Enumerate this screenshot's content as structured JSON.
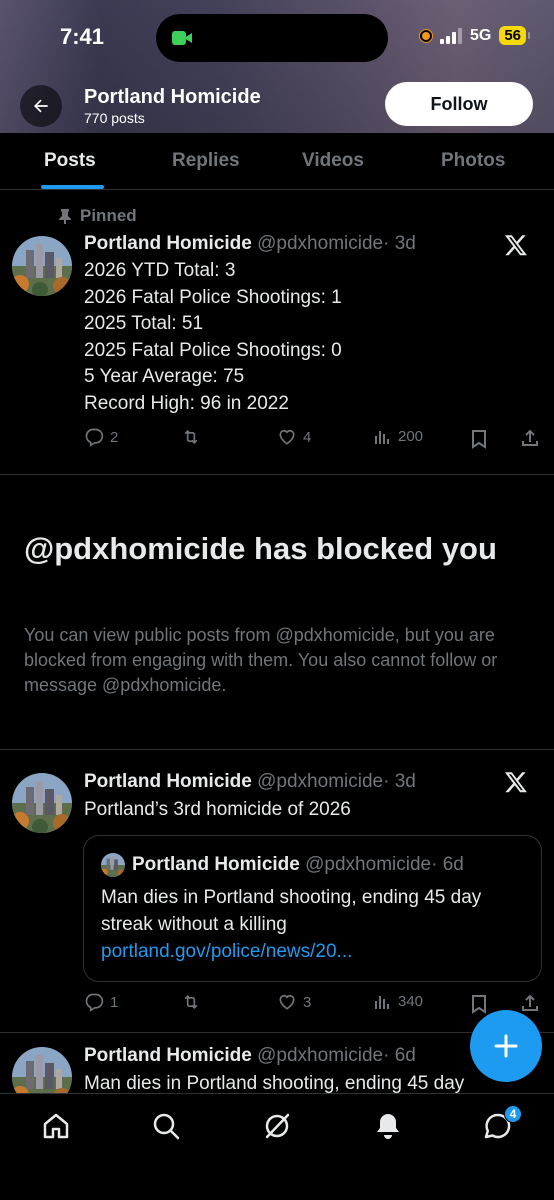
{
  "status_bar": {
    "time": "7:41",
    "network": "5G",
    "battery": "56"
  },
  "header": {
    "title": "Portland Homicide",
    "post_count": "770 posts",
    "follow_label": "Follow"
  },
  "tabs": [
    {
      "label": "Posts",
      "active": true
    },
    {
      "label": "Replies",
      "active": false
    },
    {
      "label": "Videos",
      "active": false
    },
    {
      "label": "Photos",
      "active": false
    }
  ],
  "pinned_tweet": {
    "pinned_label": "Pinned",
    "author": "Portland Homicide",
    "handle": "@pdxhomicide",
    "time": "· 3d",
    "lines": [
      "2026 YTD Total: 3",
      "2026 Fatal Police Shootings: 1",
      "2025 Total: 51",
      "2025 Fatal Police Shootings: 0",
      "5 Year Average: 75",
      "Record High: 96 in 2022"
    ],
    "replies": "2",
    "reposts": "",
    "likes": "4",
    "views": "200"
  },
  "blocked_notice": {
    "title": "@pdxhomicide has blocked you",
    "text": "You can view public posts from @pdxhomicide, but you are blocked from engaging with them. You also cannot follow or message @pdxhomicide."
  },
  "tweet2": {
    "author": "Portland Homicide",
    "handle": "@pdxhomicide",
    "time": "· 3d",
    "text": "Portland’s 3rd homicide of 2026",
    "quote": {
      "author": "Portland Homicide",
      "handle": "@pdxhomicide",
      "time": "· 6d",
      "text": "Man dies in Portland shooting, ending 45 day streak without a killing ",
      "link": "portland.gov/police/news/20..."
    },
    "replies": "1",
    "reposts": "",
    "likes": "3",
    "views": "340"
  },
  "tweet3": {
    "author": "Portland Homicide",
    "handle": "@pdxhomicide",
    "time": "· 6d",
    "text": "Man dies in Portland shooting, ending 45 day"
  },
  "bottom_nav": {
    "messages_badge": "4"
  },
  "colors": {
    "accent": "#1d9bf0",
    "background": "#000000",
    "secondary_text": "#71767b",
    "border": "#2f3336"
  }
}
